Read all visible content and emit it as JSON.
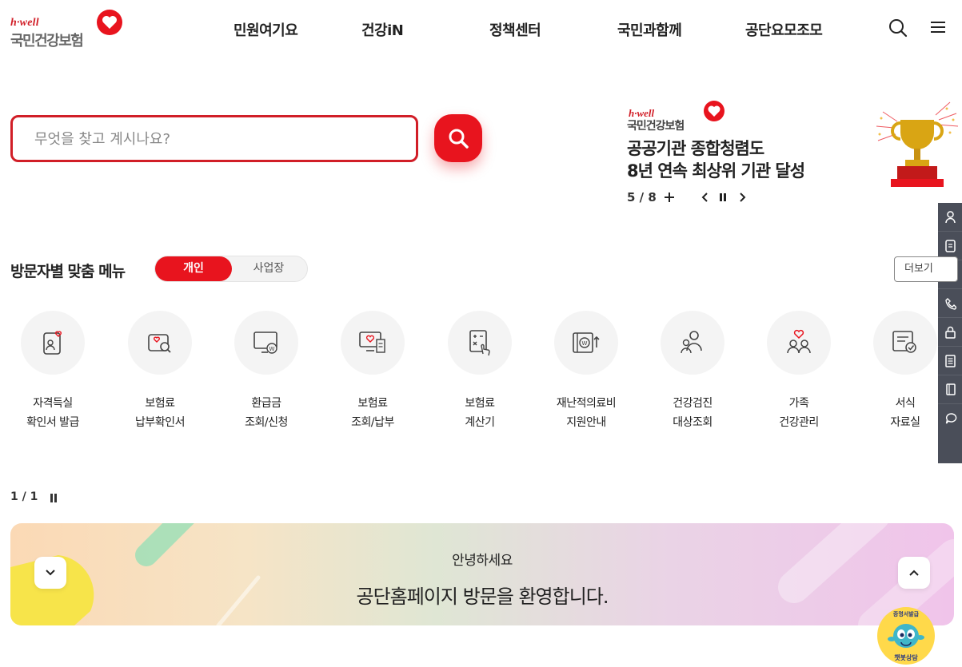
{
  "header": {
    "logo_brand": "h·well",
    "logo_name": "국민건강보험",
    "nav": [
      "민원여기요",
      "건강iN",
      "정책센터",
      "국민과함께",
      "공단요모조모"
    ],
    "search_icon": "search-icon",
    "menu_icon": "hamburger-menu-icon"
  },
  "search": {
    "placeholder": "무엇을 찾고 계시나요?",
    "value": ""
  },
  "banner": {
    "brand": "h·well",
    "name": "국민건강보험",
    "title_line1": "공공기관 종합청렴도",
    "title_line2": "8년 연속 최상위 기관 달성",
    "counter": "5 / 8"
  },
  "visitor_menu": {
    "title": "방문자별 맞춤 메뉴",
    "tab_personal": "개인",
    "tab_business": "사업장",
    "more": "더보기",
    "items": [
      {
        "line1": "자격득실",
        "line2": "확인서 발급",
        "icon": "certificate-icon"
      },
      {
        "line1": "보험료",
        "line2": "납부확인서",
        "icon": "payment-confirm-icon"
      },
      {
        "line1": "환급금",
        "line2": "조회/신청",
        "icon": "refund-monitor-icon"
      },
      {
        "line1": "보험료",
        "line2": "조회/납부",
        "icon": "premium-inquiry-icon"
      },
      {
        "line1": "보험료",
        "line2": "계산기",
        "icon": "calculator-icon"
      },
      {
        "line1": "재난적의료비",
        "line2": "지원안내",
        "icon": "medical-support-icon"
      },
      {
        "line1": "건강검진",
        "line2": "대상조회",
        "icon": "checkup-people-icon"
      },
      {
        "line1": "가족",
        "line2": "건강관리",
        "icon": "family-health-icon"
      },
      {
        "line1": "서식",
        "line2": "자료실",
        "icon": "forms-archive-icon"
      }
    ],
    "pager": "1 / 1"
  },
  "quick_menu": [
    "user-icon",
    "document-icon",
    "monitor-icon",
    "phone-icon",
    "lock-icon",
    "list-icon",
    "book-icon",
    "chat-icon"
  ],
  "welcome": {
    "greeting": "안녕하세요",
    "message": "공단홈페이지 방문을 환영합니다."
  },
  "chatbot": {
    "top_text": "증명서발급",
    "bottom_text": "챗봇상담"
  },
  "colors": {
    "brand_red": "#e8141e",
    "quick_bg": "#4a4e59"
  }
}
